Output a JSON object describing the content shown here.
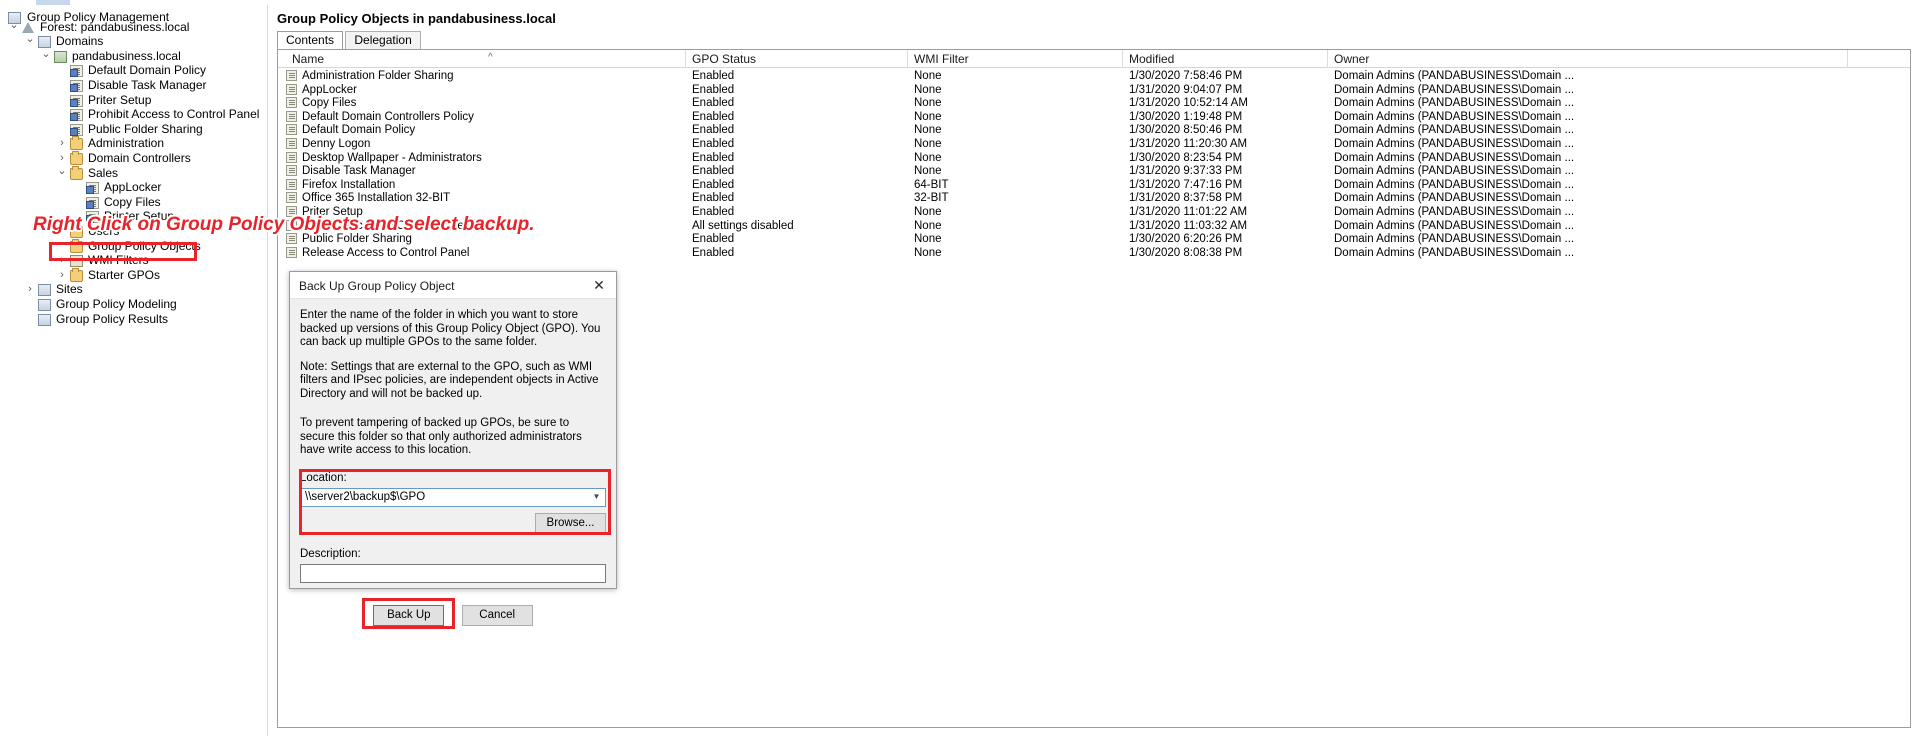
{
  "window": {
    "app_title": "Group Policy Management"
  },
  "tree": {
    "root_label": "Group Policy Management",
    "items": [
      {
        "label": "Forest: pandabusiness.local",
        "indent": 0,
        "twist": "v",
        "icon": "forest-icon"
      },
      {
        "label": "Domains",
        "indent": 1,
        "twist": "v",
        "icon": "domains-icon"
      },
      {
        "label": "pandabusiness.local",
        "indent": 2,
        "twist": "v",
        "icon": "domain-icon"
      },
      {
        "label": "Default Domain Policy",
        "indent": 3,
        "twist": "",
        "icon": "gpo-icon"
      },
      {
        "label": "Disable Task Manager",
        "indent": 3,
        "twist": "",
        "icon": "gpo-icon"
      },
      {
        "label": "Priter Setup",
        "indent": 3,
        "twist": "",
        "icon": "gpo-icon"
      },
      {
        "label": "Prohibit Access to Control Panel",
        "indent": 3,
        "twist": "",
        "icon": "gpo-icon"
      },
      {
        "label": "Public Folder Sharing",
        "indent": 3,
        "twist": "",
        "icon": "gpo-icon"
      },
      {
        "label": "Administration",
        "indent": 3,
        "twist": ">",
        "icon": "ou-folder-icon"
      },
      {
        "label": "Domain Controllers",
        "indent": 3,
        "twist": ">",
        "icon": "ou-folder-icon"
      },
      {
        "label": "Sales",
        "indent": 3,
        "twist": "v",
        "icon": "ou-folder-icon"
      },
      {
        "label": "AppLocker",
        "indent": 4,
        "twist": "",
        "icon": "gpo-locked-icon"
      },
      {
        "label": "Copy Files",
        "indent": 4,
        "twist": "",
        "icon": "gpo-icon"
      },
      {
        "label": "Printer Setup",
        "indent": 4,
        "twist": "",
        "icon": "gpo-icon"
      },
      {
        "label": "Users",
        "indent": 3,
        "twist": ">",
        "icon": "ou-folder-icon"
      },
      {
        "label": "Group Policy Objects",
        "indent": 3,
        "twist": "",
        "icon": "gpo-container-icon"
      },
      {
        "label": "WMI Filters",
        "indent": 3,
        "twist": ">",
        "icon": "wmi-icon"
      },
      {
        "label": "Starter GPOs",
        "indent": 3,
        "twist": ">",
        "icon": "starter-gpo-icon"
      },
      {
        "label": "Sites",
        "indent": 1,
        "twist": ">",
        "icon": "sites-icon"
      },
      {
        "label": "Group Policy Modeling",
        "indent": 1,
        "twist": "",
        "icon": "modeling-icon"
      },
      {
        "label": "Group Policy Results",
        "indent": 1,
        "twist": "",
        "icon": "results-icon"
      }
    ]
  },
  "main": {
    "title": "Group Policy Objects in pandabusiness.local",
    "tabs": [
      {
        "label": "Contents",
        "active": true
      },
      {
        "label": "Delegation",
        "active": false
      }
    ],
    "columns": [
      "Name",
      "GPO Status",
      "WMI Filter",
      "Modified",
      "Owner"
    ],
    "sort_indicator": "^",
    "rows": [
      {
        "name": "Administration Folder Sharing",
        "status": "Enabled",
        "wmi": "None",
        "modified": "1/30/2020 7:58:46 PM",
        "owner": "Domain Admins (PANDABUSINESS\\Domain ..."
      },
      {
        "name": "AppLocker",
        "status": "Enabled",
        "wmi": "None",
        "modified": "1/31/2020 9:04:07 PM",
        "owner": "Domain Admins (PANDABUSINESS\\Domain ..."
      },
      {
        "name": "Copy Files",
        "status": "Enabled",
        "wmi": "None",
        "modified": "1/31/2020 10:52:14 AM",
        "owner": "Domain Admins (PANDABUSINESS\\Domain ..."
      },
      {
        "name": "Default Domain Controllers Policy",
        "status": "Enabled",
        "wmi": "None",
        "modified": "1/30/2020 1:19:48 PM",
        "owner": "Domain Admins (PANDABUSINESS\\Domain ..."
      },
      {
        "name": "Default Domain Policy",
        "status": "Enabled",
        "wmi": "None",
        "modified": "1/30/2020 8:50:46 PM",
        "owner": "Domain Admins (PANDABUSINESS\\Domain ..."
      },
      {
        "name": "Denny Logon",
        "status": "Enabled",
        "wmi": "None",
        "modified": "1/31/2020 11:20:30 AM",
        "owner": "Domain Admins (PANDABUSINESS\\Domain ..."
      },
      {
        "name": "Desktop Wallpaper - Administrators",
        "status": "Enabled",
        "wmi": "None",
        "modified": "1/30/2020 8:23:54 PM",
        "owner": "Domain Admins (PANDABUSINESS\\Domain ..."
      },
      {
        "name": "Disable Task Manager",
        "status": "Enabled",
        "wmi": "None",
        "modified": "1/31/2020 9:37:33 PM",
        "owner": "Domain Admins (PANDABUSINESS\\Domain ..."
      },
      {
        "name": "Firefox Installation",
        "status": "Enabled",
        "wmi": "64-BIT",
        "modified": "1/31/2020 7:47:16 PM",
        "owner": "Domain Admins (PANDABUSINESS\\Domain ..."
      },
      {
        "name": "Office 365 Installation 32-BIT",
        "status": "Enabled",
        "wmi": "32-BIT",
        "modified": "1/31/2020 8:37:58 PM",
        "owner": "Domain Admins (PANDABUSINESS\\Domain ..."
      },
      {
        "name": "Priter Setup",
        "status": "Enabled",
        "wmi": "None",
        "modified": "1/31/2020 11:01:22 AM",
        "owner": "Domain Admins (PANDABUSINESS\\Domain ..."
      },
      {
        "name": "Prohibit Access to Control Panel",
        "status": "All settings disabled",
        "wmi": "None",
        "modified": "1/31/2020 11:03:32 AM",
        "owner": "Domain Admins (PANDABUSINESS\\Domain ..."
      },
      {
        "name": "Public Folder Sharing",
        "status": "Enabled",
        "wmi": "None",
        "modified": "1/30/2020 6:20:26 PM",
        "owner": "Domain Admins (PANDABUSINESS\\Domain ..."
      },
      {
        "name": "Release Access to Control Panel",
        "status": "Enabled",
        "wmi": "None",
        "modified": "1/30/2020 8:08:38 PM",
        "owner": "Domain Admins (PANDABUSINESS\\Domain ..."
      }
    ]
  },
  "annotation": {
    "text": "Right Click on Group Policy Objects and select backup.",
    "color": "#e8232a"
  },
  "dialog": {
    "title": "Back Up Group Policy Object",
    "close_glyph": "✕",
    "paragraph1": "Enter the name of the folder in which you want to store backed up versions of this Group Policy Object (GPO). You can back up multiple GPOs to the same folder.",
    "paragraph2": "Note: Settings that are external to the GPO, such as WMI filters and IPsec policies, are independent objects in Active Directory and will not be backed up.",
    "paragraph3": "To prevent tampering of backed up GPOs, be sure to secure this folder so that only authorized administrators have write access to this location.",
    "location_label": "Location:",
    "location_value": "\\\\server2\\backup$\\GPO",
    "browse_label": "Browse...",
    "description_label": "Description:",
    "description_value": "",
    "backup_button": "Back Up",
    "cancel_button": "Cancel"
  }
}
